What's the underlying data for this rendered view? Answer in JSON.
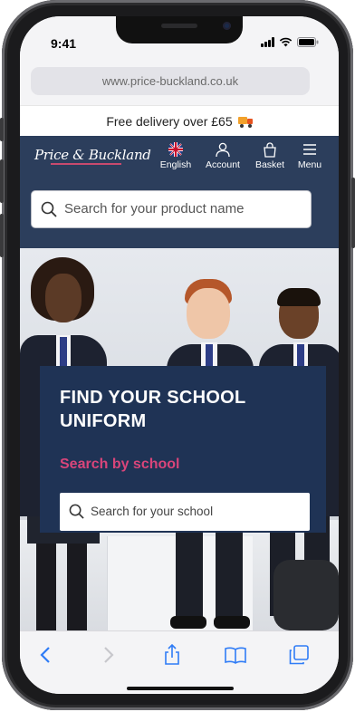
{
  "status_bar": {
    "time": "9:41"
  },
  "browser": {
    "url": "www.price-buckland.co.uk"
  },
  "promo": {
    "text": "Free delivery over £65"
  },
  "header": {
    "logo_text": "Price & Buckland",
    "nav": [
      {
        "label": "English",
        "icon": "uk-flag-icon"
      },
      {
        "label": "Account",
        "icon": "account-icon"
      },
      {
        "label": "Basket",
        "icon": "basket-icon"
      },
      {
        "label": "Menu",
        "icon": "menu-icon"
      }
    ]
  },
  "product_search": {
    "placeholder": "Search for your product name"
  },
  "hero": {
    "title": "FIND YOUR SCHOOL UNIFORM",
    "subtitle": "Search by school",
    "school_search": {
      "placeholder": "Search for your school"
    }
  },
  "toolbar": {
    "items": [
      "back-icon",
      "forward-icon",
      "share-icon",
      "bookmarks-icon",
      "tabs-icon"
    ]
  },
  "colors": {
    "navy": "#2c3e5c",
    "panel": "#1f3355",
    "accent_pink": "#d9457a"
  }
}
